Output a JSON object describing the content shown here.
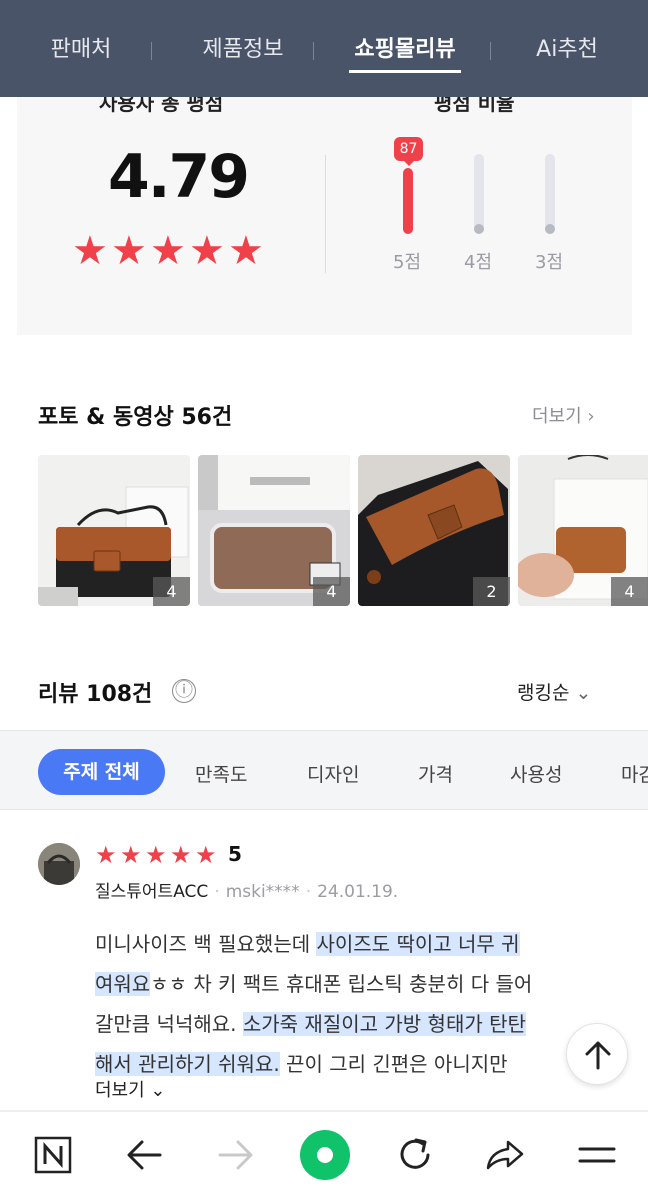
{
  "tabs": [
    {
      "label": "판매처"
    },
    {
      "label": "제품정보"
    },
    {
      "label": "쇼핑몰리뷰",
      "active": true
    },
    {
      "label": "Ai추천"
    }
  ],
  "rating_summary": {
    "cut_left": "사용자 총 평점",
    "cut_right": "평점 비율",
    "score": "4.79",
    "stars": 5,
    "bars": [
      {
        "label": "5점",
        "percent": 87,
        "bubble": "87"
      },
      {
        "label": "4점",
        "percent": 0
      },
      {
        "label": "3점",
        "percent": 0
      }
    ],
    "accent_color": "#f0414a"
  },
  "photos": {
    "title": "포토 & 동영상 56건",
    "more": "더보기",
    "items": [
      {
        "count": "4",
        "icon": "bag-photo"
      },
      {
        "count": "4",
        "icon": "package-photo"
      },
      {
        "count": "2",
        "icon": "bag-photo"
      },
      {
        "count": "4",
        "icon": "wallet-photo"
      }
    ]
  },
  "reviews_header": {
    "title": "리뷰 108건",
    "info_icon": "ⓘ",
    "sort": "랭킹순"
  },
  "topics": {
    "active": "주제 전체",
    "items": [
      "만족도",
      "디자인",
      "가격",
      "사용성",
      "마감"
    ]
  },
  "review": {
    "score": "5",
    "stars": 5,
    "store": "질스튜어트ACC",
    "user": "mski****",
    "date": "24.01.19.",
    "lines": [
      [
        {
          "t": "미니사이즈 백 필요했는데 "
        },
        {
          "t": "사이즈도 딱이고 너무 귀",
          "hl": true
        }
      ],
      [
        {
          "t": "여워요",
          "hl": true
        },
        {
          "t": "ㅎㅎ 차 키 팩트 휴대폰 립스틱 충분히 다 들어"
        }
      ],
      [
        {
          "t": "갈만큼 넉넉해요. "
        },
        {
          "t": "소가죽 재질이고 가방 형태가 탄탄",
          "hl": true
        }
      ],
      [
        {
          "t": "해서 ",
          "hl": true
        },
        {
          "t": "관리하기 쉬워요.",
          "hl": true
        },
        {
          "t": " 끈이 그리 긴편은 아니지만"
        }
      ]
    ],
    "more": "더보기"
  },
  "bottom_nav": [
    "naver-n-icon",
    "back-arrow-icon",
    "forward-arrow-icon",
    "home-circle-icon",
    "refresh-icon",
    "share-icon",
    "menu-icon"
  ]
}
